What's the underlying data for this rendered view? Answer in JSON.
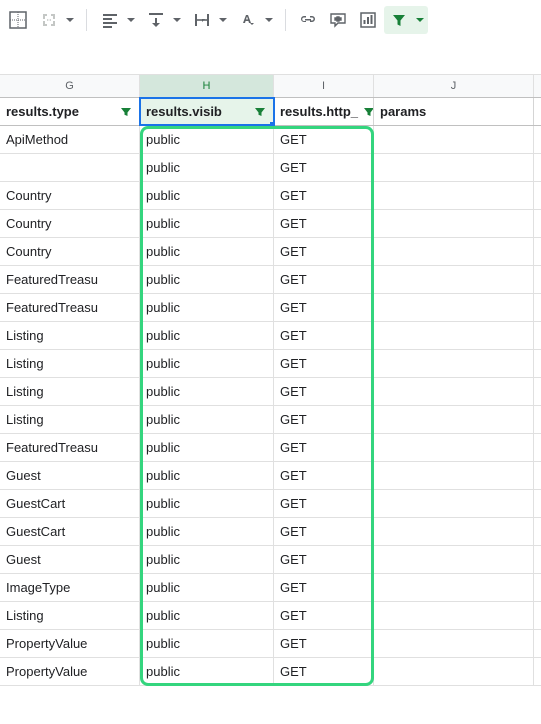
{
  "toolbar": {
    "borders": "borders",
    "merge": "merge-cells",
    "halign": "horizontal-align",
    "valign": "vertical-align",
    "wrap": "text-wrapping",
    "rotate": "text-rotation",
    "link": "insert-link",
    "comment": "insert-comment",
    "chart": "insert-chart",
    "filter": "filter"
  },
  "columns": {
    "G": "G",
    "H": "H",
    "I": "I",
    "J": "J"
  },
  "headers": {
    "G": "results.type",
    "H": "results.visib",
    "I": "results.http_",
    "J": "params"
  },
  "rows": [
    {
      "G": "ApiMethod",
      "H": "public",
      "I": "GET",
      "J": ""
    },
    {
      "G": "",
      "H": "public",
      "I": "GET",
      "J": ""
    },
    {
      "G": "Country",
      "H": "public",
      "I": "GET",
      "J": ""
    },
    {
      "G": "Country",
      "H": "public",
      "I": "GET",
      "J": ""
    },
    {
      "G": "Country",
      "H": "public",
      "I": "GET",
      "J": ""
    },
    {
      "G": "FeaturedTreasu",
      "H": "public",
      "I": "GET",
      "J": ""
    },
    {
      "G": "FeaturedTreasu",
      "H": "public",
      "I": "GET",
      "J": ""
    },
    {
      "G": "Listing",
      "H": "public",
      "I": "GET",
      "J": ""
    },
    {
      "G": "Listing",
      "H": "public",
      "I": "GET",
      "J": ""
    },
    {
      "G": "Listing",
      "H": "public",
      "I": "GET",
      "J": ""
    },
    {
      "G": "Listing",
      "H": "public",
      "I": "GET",
      "J": ""
    },
    {
      "G": "FeaturedTreasu",
      "H": "public",
      "I": "GET",
      "J": ""
    },
    {
      "G": "Guest",
      "H": "public",
      "I": "GET",
      "J": ""
    },
    {
      "G": "GuestCart",
      "H": "public",
      "I": "GET",
      "J": ""
    },
    {
      "G": "GuestCart",
      "H": "public",
      "I": "GET",
      "J": ""
    },
    {
      "G": "Guest",
      "H": "public",
      "I": "GET",
      "J": ""
    },
    {
      "G": "ImageType",
      "H": "public",
      "I": "GET",
      "J": ""
    },
    {
      "G": "Listing",
      "H": "public",
      "I": "GET",
      "J": ""
    },
    {
      "G": "PropertyValue",
      "H": "public",
      "I": "GET",
      "J": ""
    },
    {
      "G": "PropertyValue",
      "H": "public",
      "I": "GET",
      "J": ""
    }
  ],
  "highlight": {
    "rows": 20
  }
}
